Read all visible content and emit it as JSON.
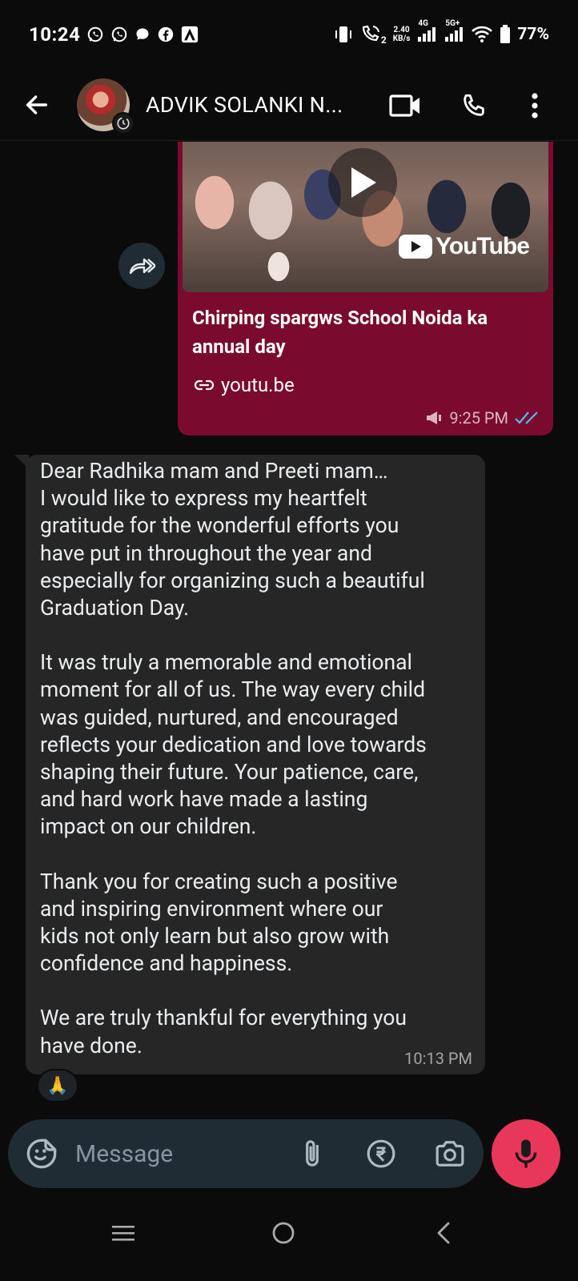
{
  "status_bar": {
    "time": "10:24",
    "net_speed_value": "2.40",
    "net_speed_unit": "KB/s",
    "sim1_label": "4G",
    "sim2_label": "5G+",
    "call_sim": "2",
    "battery": "77%"
  },
  "header": {
    "contact_name": "ADVIK SOLANKI N...",
    "icons": [
      "back-arrow-icon",
      "video-call-icon",
      "phone-call-icon",
      "more-options-icon"
    ]
  },
  "outgoing_message": {
    "link_title": "Chirping spargws School Noida ka annual day",
    "link_domain": "youtu.be",
    "youtube_wordmark": "YouTube",
    "time": "9:25 PM",
    "bubble_color": "#7a0a2e",
    "status": "read"
  },
  "incoming_message": {
    "paragraphs": [
      "Dear Radhika mam and Preeti mam…\nI would like to express my heartfelt\ngratitude for the wonderful efforts you\nhave put in throughout the year and\nespecially for organizing such a beautiful\nGraduation Day.",
      "It was truly a memorable and emotional\nmoment for all of us. The way every child\nwas guided, nurtured, and encouraged\nreflects your dedication and love towards\nshaping their future. Your patience, care,\nand hard work have made a lasting\nimpact on our children.",
      "Thank you for creating such a positive\nand inspiring environment where our\nkids not only learn but also grow with\nconfidence and happiness.",
      "We are truly thankful for everything you\nhave done."
    ],
    "time": "10:13 PM",
    "reaction": "🙏"
  },
  "composer": {
    "placeholder": "Message",
    "icons": [
      "sticker-icon",
      "attach-icon",
      "rupee-payment-icon",
      "camera-icon",
      "microphone-icon"
    ],
    "mic_color": "#e8375b"
  },
  "nav_bar": {
    "buttons": [
      "recents-button",
      "home-button",
      "back-button"
    ]
  }
}
